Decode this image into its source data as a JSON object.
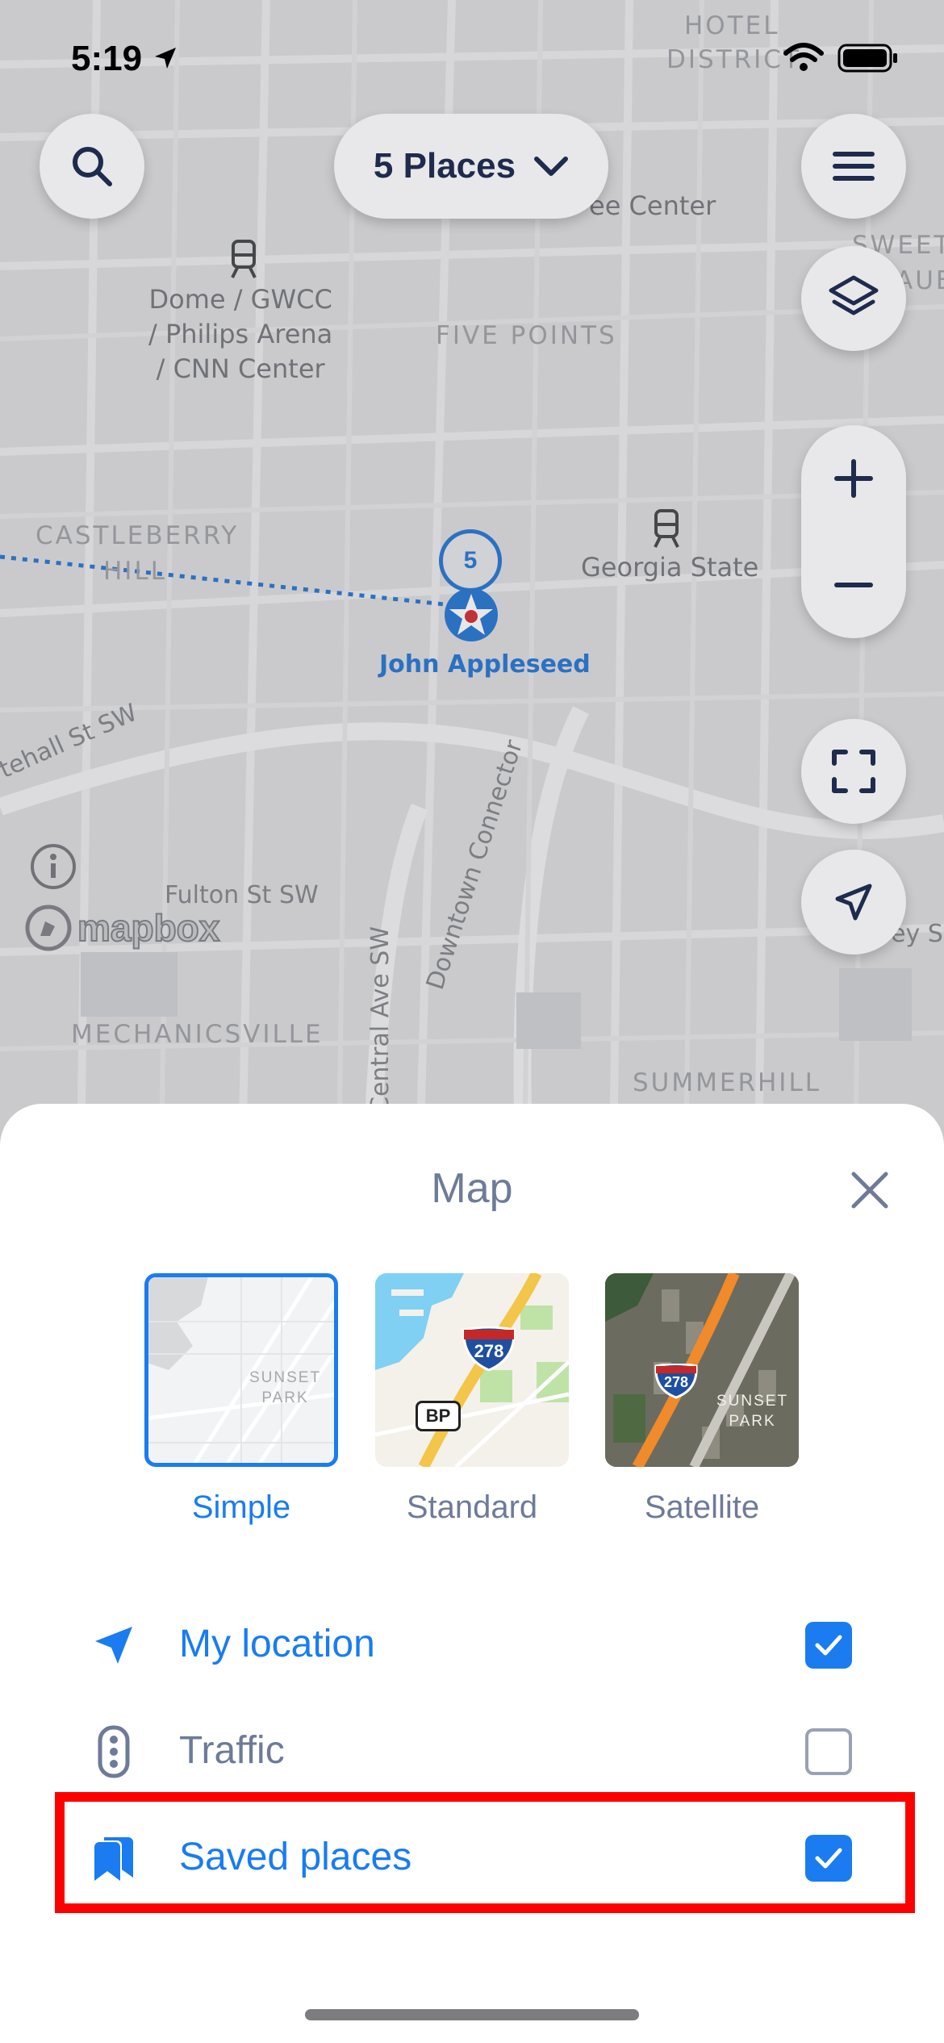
{
  "status_bar": {
    "time": "5:19"
  },
  "map": {
    "places_button_label": "5 Places",
    "districts": [
      "HOTEL",
      "DISTRICT",
      "FIVE POINTS",
      "CASTLEBERRY",
      "HILL",
      "MECHANICSVILLE",
      "SUMMERHILL",
      "SWEET",
      "AUB"
    ],
    "pois": [
      "Dome / GWCC",
      "/ Philips Arena",
      "/ CNN Center",
      "Georgia State",
      "ee Center"
    ],
    "roads": [
      "tehall St SW",
      "Fulton St SW",
      "Central Ave SW",
      "Downtown Connector",
      "ey Sy"
    ],
    "cluster_count": "5",
    "user_name": "John Appleseed",
    "attribution": "mapbox"
  },
  "sheet": {
    "title": "Map",
    "styles": [
      {
        "label": "Simple",
        "thumb_text_1": "SUNSET",
        "thumb_text_2": "PARK",
        "selected": true
      },
      {
        "label": "Standard",
        "shield": "278",
        "badge": "BP",
        "selected": false
      },
      {
        "label": "Satellite",
        "shield": "278",
        "thumb_text_1": "SUNSET",
        "thumb_text_2": "PARK",
        "selected": false
      }
    ],
    "options": [
      {
        "label": "My location",
        "checked": true
      },
      {
        "label": "Traffic",
        "checked": false
      },
      {
        "label": "Saved places",
        "checked": true
      }
    ]
  },
  "colors": {
    "accent": "#1a7cf0",
    "inactive_text": "#6e7b98",
    "highlight": "#ff0000"
  }
}
